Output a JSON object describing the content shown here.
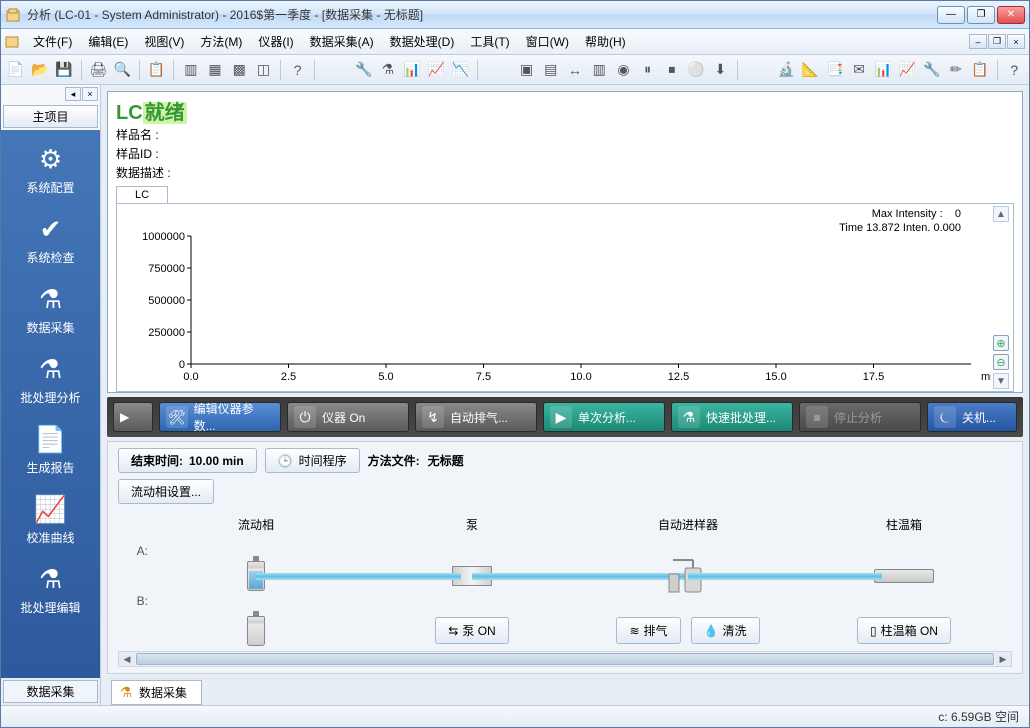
{
  "title": "分析 (LC-01 - System Administrator) - 2016$第一季度 - [数据采集 - 无标题]",
  "menu": [
    "文件(F)",
    "编辑(E)",
    "视图(V)",
    "方法(M)",
    "仪器(I)",
    "数据采集(A)",
    "数据处理(D)",
    "工具(T)",
    "窗口(W)",
    "帮助(H)"
  ],
  "sidebar": {
    "mainTab": "主项目",
    "items": [
      {
        "label": "系统配置",
        "icon": "⚙"
      },
      {
        "label": "系统检查",
        "icon": "✔"
      },
      {
        "label": "数据采集",
        "icon": "⚗"
      },
      {
        "label": "批处理分析",
        "icon": "⚗"
      },
      {
        "label": "生成报告",
        "icon": "📄"
      },
      {
        "label": "校准曲线",
        "icon": "📈"
      },
      {
        "label": "批处理编辑",
        "icon": "⚗"
      }
    ],
    "footerTab": "数据采集"
  },
  "status": {
    "prefix": "LC",
    "text": "就绪"
  },
  "meta": {
    "sampleName": "样品名 :",
    "sampleId": "样品ID :",
    "dataDesc": "数据描述 :"
  },
  "lcTab": "LC",
  "chart_data": {
    "type": "line",
    "title": "",
    "max_intensity_label": "Max Intensity :",
    "max_intensity_value": "0",
    "info_line": "Time   13.872    Inten.             0.000",
    "xlabel": "min",
    "ylabel": "",
    "xlim": [
      0,
      20
    ],
    "ylim": [
      0,
      1000000
    ],
    "xticks": [
      0.0,
      2.5,
      5.0,
      7.5,
      10.0,
      12.5,
      15.0,
      17.5
    ],
    "yticks": [
      0,
      250000,
      500000,
      750000,
      1000000
    ],
    "series": [
      {
        "name": "Inten.",
        "x": [],
        "y": []
      }
    ]
  },
  "actions": {
    "small_toggle": "▶",
    "editParams": "编辑仪器参数...",
    "instrumentOn": "仪器 On",
    "autoPurge": "自动排气...",
    "singleAnalysis": "单次分析...",
    "quickBatch": "快速批处理...",
    "stopAnalysis": "停止分析",
    "shutdown": "关机..."
  },
  "config": {
    "endTimeLabel": "结束时间:",
    "endTimeValue": "10.00 min",
    "timeProgram": "时间程序",
    "methodFileLabel": "方法文件:",
    "methodFileValue": "无标题",
    "mobilePhaseSettings": "流动相设置...",
    "cols": {
      "mobile": "流动相",
      "pump": "泵",
      "sampler": "自动进样器",
      "oven": "柱温箱"
    },
    "ab": {
      "a": "A:",
      "b": "B:"
    },
    "buttons": {
      "pumpOn": "泵 ON",
      "purge": "排气",
      "wash": "清洗",
      "ovenOn": "柱温箱 ON"
    }
  },
  "bottomTab": "数据采集",
  "statusbar": "c:   6.59GB 空间"
}
